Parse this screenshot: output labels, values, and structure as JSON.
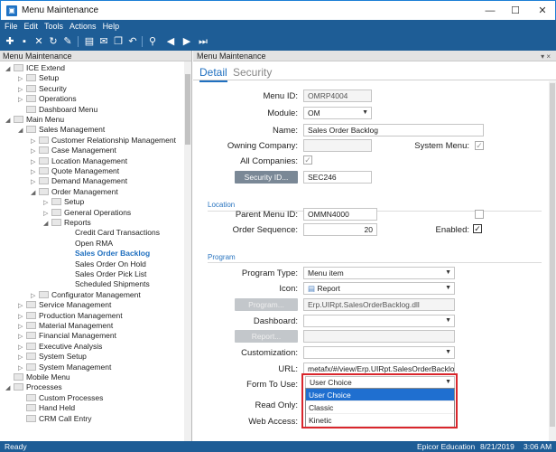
{
  "window": {
    "title": "Menu Maintenance",
    "app_icon": "epicor-app-icon",
    "minimize": "—",
    "maximize": "☐",
    "close": "✕"
  },
  "menubar": [
    "File",
    "Edit",
    "Tools",
    "Actions",
    "Help"
  ],
  "toolbar": {
    "icons": [
      "new-icon",
      "save-icon",
      "delete-icon",
      "refresh-icon",
      "clear-icon",
      "print-icon",
      "attach-icon",
      "copy-icon",
      "undo-icon",
      "search-icon",
      "back-icon",
      "forward-icon",
      "last-icon"
    ]
  },
  "left_pane": {
    "header": "Menu Maintenance",
    "tree": [
      {
        "label": "ICE Extend",
        "level": 0,
        "expander": "◢",
        "folder": true
      },
      {
        "label": "Setup",
        "level": 1,
        "expander": "▷",
        "folder": true
      },
      {
        "label": "Security",
        "level": 1,
        "expander": "▷",
        "folder": true
      },
      {
        "label": "Operations",
        "level": 1,
        "expander": "▷",
        "folder": true
      },
      {
        "label": "Dashboard Menu",
        "level": 1,
        "expander": "",
        "folder": true
      },
      {
        "label": "Main Menu",
        "level": 0,
        "expander": "◢",
        "folder": true
      },
      {
        "label": "Sales Management",
        "level": 1,
        "expander": "◢",
        "folder": true
      },
      {
        "label": "Customer Relationship Management",
        "level": 2,
        "expander": "▷",
        "folder": true
      },
      {
        "label": "Case Management",
        "level": 2,
        "expander": "▷",
        "folder": true
      },
      {
        "label": "Location Management",
        "level": 2,
        "expander": "▷",
        "folder": true
      },
      {
        "label": "Quote Management",
        "level": 2,
        "expander": "▷",
        "folder": true
      },
      {
        "label": "Demand Management",
        "level": 2,
        "expander": "▷",
        "folder": true
      },
      {
        "label": "Order Management",
        "level": 2,
        "expander": "◢",
        "folder": true
      },
      {
        "label": "Setup",
        "level": 3,
        "expander": "▷",
        "folder": true
      },
      {
        "label": "General Operations",
        "level": 3,
        "expander": "▷",
        "folder": true
      },
      {
        "label": "Reports",
        "level": 3,
        "expander": "◢",
        "folder": true
      },
      {
        "label": "Credit Card Transactions",
        "level": 4,
        "expander": "",
        "folder": false
      },
      {
        "label": "Open RMA",
        "level": 4,
        "expander": "",
        "folder": false
      },
      {
        "label": "Sales Order Backlog",
        "level": 4,
        "expander": "",
        "folder": false,
        "selected": true
      },
      {
        "label": "Sales Order On Hold",
        "level": 4,
        "expander": "",
        "folder": false
      },
      {
        "label": "Sales Order Pick List",
        "level": 4,
        "expander": "",
        "folder": false
      },
      {
        "label": "Scheduled Shipments",
        "level": 4,
        "expander": "",
        "folder": false
      },
      {
        "label": "Configurator Management",
        "level": 2,
        "expander": "▷",
        "folder": true
      },
      {
        "label": "Service Management",
        "level": 1,
        "expander": "▷",
        "folder": true
      },
      {
        "label": "Production Management",
        "level": 1,
        "expander": "▷",
        "folder": true
      },
      {
        "label": "Material Management",
        "level": 1,
        "expander": "▷",
        "folder": true
      },
      {
        "label": "Financial Management",
        "level": 1,
        "expander": "▷",
        "folder": true
      },
      {
        "label": "Executive Analysis",
        "level": 1,
        "expander": "▷",
        "folder": true
      },
      {
        "label": "System Setup",
        "level": 1,
        "expander": "▷",
        "folder": true
      },
      {
        "label": "System Management",
        "level": 1,
        "expander": "▷",
        "folder": true
      },
      {
        "label": "Mobile Menu",
        "level": 0,
        "expander": "",
        "folder": true
      },
      {
        "label": "Processes",
        "level": 0,
        "expander": "◢",
        "folder": true
      },
      {
        "label": "Custom Processes",
        "level": 1,
        "expander": "",
        "folder": true
      },
      {
        "label": "Hand Held",
        "level": 1,
        "expander": "",
        "folder": true
      },
      {
        "label": "CRM Call Entry",
        "level": 1,
        "expander": "",
        "folder": true
      }
    ]
  },
  "right_pane": {
    "header": "Menu Maintenance",
    "pin": "▾ ×",
    "tabs": [
      "Detail",
      "Security"
    ],
    "fields": {
      "menu_id_label": "Menu ID:",
      "menu_id": "OMRP4004",
      "module_label": "Module:",
      "module": "OM",
      "name_label": "Name:",
      "name": "Sales Order Backlog",
      "owning_company_label": "Owning Company:",
      "owning_company": "",
      "system_menu_label": "System Menu:",
      "system_menu_check": "✓",
      "all_companies_label": "All Companies:",
      "all_companies_check": "✓",
      "security_id_button": "Security ID...",
      "security_id": "SEC246",
      "location_section": "Location",
      "parent_menu_label": "Parent Menu ID:",
      "parent_menu": "OMMN4000",
      "parent_check": "",
      "order_seq_label": "Order Sequence:",
      "order_seq": "20",
      "enabled_label": "Enabled:",
      "enabled_check": "✓",
      "program_section": "Program",
      "program_type_label": "Program Type:",
      "program_type": "Menu item",
      "icon_label": "Icon:",
      "icon_value": "Report",
      "program_button": "Program...",
      "program_value": "Erp.UIRpt.SalesOrderBacklog.dll",
      "dashboard_label": "Dashboard:",
      "dashboard": "",
      "report_button": "Report...",
      "report_value": "",
      "customization_label": "Customization:",
      "customization": "",
      "url_label": "URL:",
      "url": "metafx/#/view/Erp.UIRpt.SalesOrderBacklog",
      "form_to_use_label": "Form To Use:",
      "form_to_use": "User Choice",
      "read_only_label": "Read Only:",
      "web_access_label": "Web Access:"
    },
    "form_options": [
      "User Choice",
      "Classic",
      "Kinetic"
    ]
  },
  "statusbar": {
    "left": "Ready",
    "company": "Epicor Education",
    "date": "8/21/2019",
    "time": "3:06 AM"
  }
}
